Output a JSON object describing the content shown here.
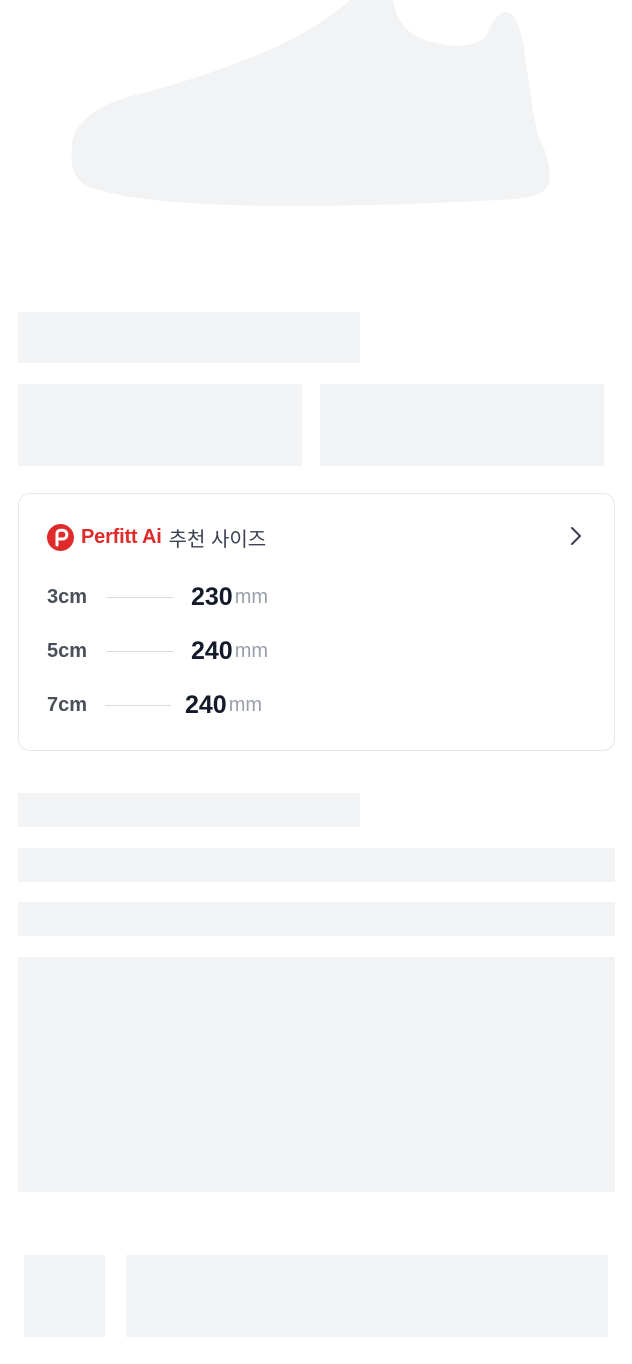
{
  "product": {
    "image_icon": "shoe-silhouette-icon"
  },
  "size_card": {
    "logo_icon": "perfitt-logo-icon",
    "brand": "Perfitt Ai",
    "suffix": "추천 사이즈",
    "arrow_icon": "chevron-right-icon",
    "rows": [
      {
        "label": "3cm",
        "value": "230",
        "unit": "mm"
      },
      {
        "label": "5cm",
        "value": "240",
        "unit": "mm"
      },
      {
        "label": "7cm",
        "value": "240",
        "unit": "mm"
      }
    ]
  },
  "colors": {
    "brand": "#e02b2b",
    "skeleton": "#f2f3f5"
  }
}
